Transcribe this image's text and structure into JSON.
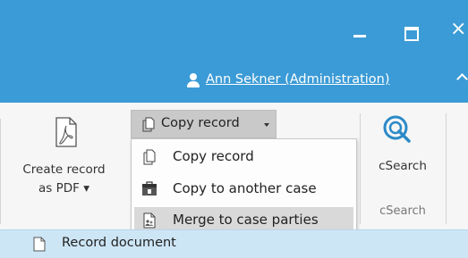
{
  "window": {
    "close_glyph": "×"
  },
  "user": {
    "link_text": "Ann Sekner (Administration)"
  },
  "ribbon": {
    "create_pdf_line1": "Create record",
    "create_pdf_line2": "as PDF ▾",
    "copy_record_button": "Copy record",
    "csearch_button": "cSearch",
    "csearch_group": "cSearch"
  },
  "menu": {
    "items": [
      {
        "label": "Copy record",
        "icon": "copy-record-icon"
      },
      {
        "label": "Copy to another case",
        "icon": "copy-to-case-icon"
      },
      {
        "label": "Merge to case parties",
        "icon": "merge-icon"
      }
    ],
    "highlighted_index": 2
  },
  "document_bar": {
    "label": "Record document"
  },
  "colors": {
    "titlebar": "#3b9bd6",
    "accent": "#2c8ac7",
    "doc_bar": "#cde6f6"
  }
}
